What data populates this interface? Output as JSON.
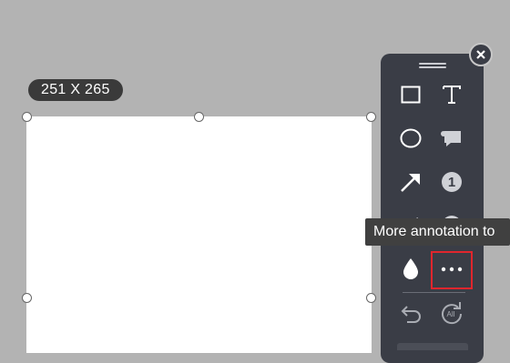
{
  "selection": {
    "dimensions_label": "251 X 265"
  },
  "toolbar": {
    "tools": [
      {
        "icon": "rectangle-icon"
      },
      {
        "icon": "text-icon"
      },
      {
        "icon": "ellipse-icon"
      },
      {
        "icon": "speech-bubble-icon"
      },
      {
        "icon": "arrow-icon"
      },
      {
        "icon": "number-marker-icon",
        "label": "1"
      },
      {
        "icon": "pen-icon"
      },
      {
        "icon": "mosaic-icon"
      },
      {
        "icon": "color-drop-icon"
      },
      {
        "icon": "more-icon"
      },
      {
        "icon": "undo-icon"
      },
      {
        "icon": "undo-all-icon",
        "label": "All"
      }
    ],
    "close_icon": "close-icon"
  },
  "tooltip": {
    "text": "More annotation to"
  },
  "colors": {
    "toolbar_bg": "#3a3d46",
    "highlight": "#e0262d",
    "backdrop": "#b3b3b3"
  }
}
